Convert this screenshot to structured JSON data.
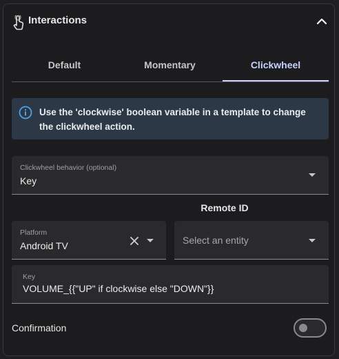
{
  "header": {
    "title": "Interactions",
    "icon": "touch-app-icon",
    "collapse_icon": "chevron-up-icon"
  },
  "tabs": [
    {
      "label": "Default",
      "active": false
    },
    {
      "label": "Momentary",
      "active": false
    },
    {
      "label": "Clickwheel",
      "active": true
    }
  ],
  "info": {
    "icon": "info-icon",
    "text": "Use the 'clockwise' boolean variable in a template to change the clickwheel action."
  },
  "clickwheel_behavior": {
    "label": "Clickwheel behavior (optional)",
    "value": "Key"
  },
  "remote_id": {
    "label": "Remote ID"
  },
  "platform": {
    "label": "Platform",
    "value": "Android TV"
  },
  "entity": {
    "placeholder": "Select an entity"
  },
  "key": {
    "label": "Key",
    "value": "VOLUME_{{\"UP\" if clockwise else \"DOWN\"}}"
  },
  "confirmation": {
    "label": "Confirmation",
    "enabled": false
  },
  "colors": {
    "accent": "#c7d0ff",
    "info_bg": "#2c3845",
    "info_icon": "#4ea3e6"
  }
}
